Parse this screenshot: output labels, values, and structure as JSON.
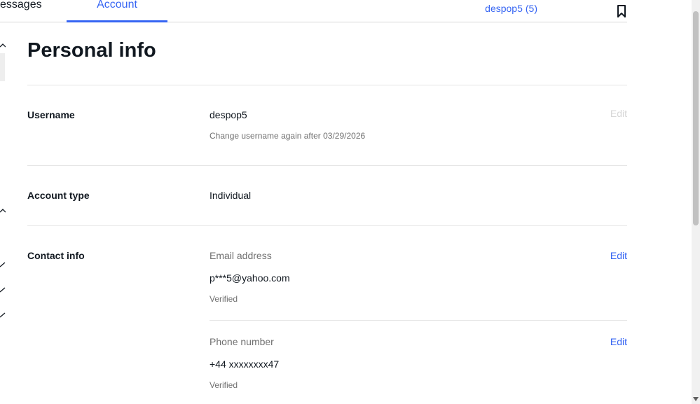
{
  "nav": {
    "tabs": [
      {
        "label": "essages"
      },
      {
        "label": "Account"
      }
    ],
    "user": {
      "name": "despop5",
      "count": "(5)"
    }
  },
  "page": {
    "title": "Personal info"
  },
  "username": {
    "label": "Username",
    "value": "despop5",
    "note": "Change username again after 03/29/2026",
    "edit": "Edit"
  },
  "account_type": {
    "label": "Account type",
    "value": "Individual"
  },
  "contact": {
    "label": "Contact info",
    "email": {
      "label": "Email address",
      "value": "p***5@yahoo.com",
      "status": "Verified",
      "edit": "Edit"
    },
    "phone": {
      "label": "Phone number",
      "value": "+44 xxxxxxxx47",
      "status": "Verified",
      "edit": "Edit"
    }
  },
  "colors": {
    "accent": "#3665f3",
    "text": "#111820",
    "muted": "#707070",
    "disabled": "#d7d7d7"
  },
  "icons": {
    "bookmark": "bookmark-icon"
  }
}
